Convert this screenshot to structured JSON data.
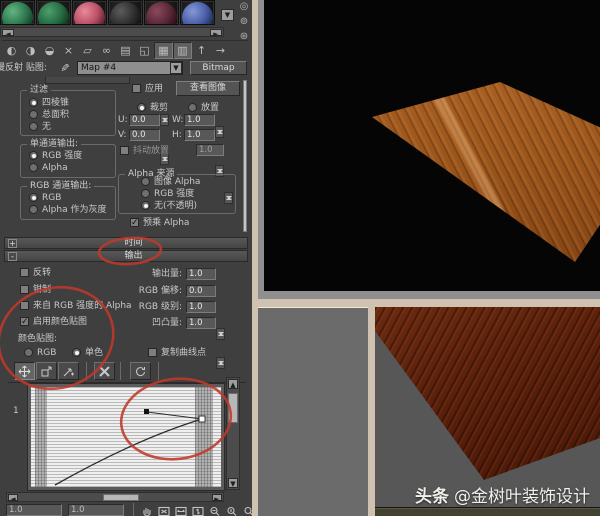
{
  "colors": {
    "annotation": "#c0392b",
    "panel_bg": "#3f3f3f",
    "window_frame_beige": "#cfc2b0",
    "render_bg": "#050505",
    "viewport_bg": "#575757",
    "wood_light": "#9a551c",
    "wood_dark": "#581f0b"
  },
  "sample_slots": [
    {
      "name": "sample-sphere-green-1",
      "color": "#2e7a50"
    },
    {
      "name": "sample-sphere-green-2",
      "color": "#256b42"
    },
    {
      "name": "sample-sphere-rose",
      "color": "#b94f66"
    },
    {
      "name": "sample-sphere-black",
      "color": "#303030"
    },
    {
      "name": "sample-sphere-maroon",
      "color": "#5c2737"
    },
    {
      "name": "sample-sphere-blue",
      "color": "#4a5fa8"
    }
  ],
  "top_toolbar": {
    "icons": [
      {
        "name": "get-material-icon",
        "glyph": "◐"
      },
      {
        "name": "put-material-to-scene-icon",
        "glyph": "◑"
      },
      {
        "name": "assign-material-to-selection-icon",
        "glyph": "◒"
      },
      {
        "name": "reset-map-icon",
        "glyph": "×"
      },
      {
        "name": "make-material-copy-icon",
        "glyph": "▱"
      },
      {
        "name": "make-unique-icon",
        "glyph": "∞"
      },
      {
        "name": "put-to-library-icon",
        "glyph": "▤"
      },
      {
        "name": "material-id-channel-icon",
        "glyph": "◱"
      },
      {
        "name": "show-map-in-viewport-icon",
        "glyph": "▦",
        "pressed": true
      },
      {
        "name": "show-end-result-icon",
        "glyph": "▥",
        "pressed": true
      },
      {
        "name": "go-to-parent-icon",
        "glyph": "↑"
      },
      {
        "name": "go-forward-to-sibling-icon",
        "glyph": "→"
      }
    ]
  },
  "side_icons": [
    {
      "name": "sample-uv-tiling-icon",
      "glyph": "◎"
    },
    {
      "name": "video-color-check-icon",
      "glyph": "⊚"
    },
    {
      "name": "options-icon",
      "glyph": "⊛"
    }
  ],
  "map_row": {
    "label": "漫反射 贴图:",
    "map_name": "Map #4",
    "type_button_label": "Bitmap"
  },
  "params": {
    "filter": {
      "title": "过滤",
      "options": [
        {
          "label": "四棱锥",
          "selected": true
        },
        {
          "label": "总面积",
          "selected": false
        },
        {
          "label": "无",
          "selected": false
        }
      ]
    },
    "apply_label": "应用",
    "view_image_label": "查看图像",
    "crop_label": "裁剪",
    "crop_selected": true,
    "place_label": "放置",
    "place_selected": false,
    "u": {
      "label": "U:",
      "value": "0.0"
    },
    "v": {
      "label": "V:",
      "value": "0.0"
    },
    "w": {
      "label": "W:",
      "value": "1.0"
    },
    "h": {
      "label": "H:",
      "value": "1.0"
    },
    "jitter": {
      "label": "抖动放置",
      "value": "1.0",
      "checked": false
    },
    "mono": {
      "title": "单通道输出:",
      "options": [
        {
          "label": "RGB 强度",
          "selected": true
        },
        {
          "label": "Alpha",
          "selected": false
        }
      ]
    },
    "rgb_out": {
      "title": "RGB 通道输出:",
      "options": [
        {
          "label": "RGB",
          "selected": true
        },
        {
          "label": "Alpha 作为灰度",
          "selected": false
        }
      ]
    },
    "alpha_source": {
      "title": "Alpha 来源",
      "options": [
        {
          "label": "图像 Alpha",
          "selected": false
        },
        {
          "label": "RGB 强度",
          "selected": false
        },
        {
          "label": "无(不透明)",
          "selected": true
        }
      ]
    },
    "premult_label": "预乘 Alpha",
    "premult_checked": true
  },
  "rollouts": {
    "time": {
      "state": "+",
      "label": "时间"
    },
    "output": {
      "state": "-",
      "label": "输出"
    }
  },
  "output": {
    "checks": [
      {
        "label": "反转",
        "checked": false
      },
      {
        "label": "钳制",
        "checked": false
      },
      {
        "label": "来自 RGB 强度的 Alpha",
        "checked": false
      },
      {
        "label": "启用颜色贴图",
        "checked": true
      }
    ],
    "spinners": [
      {
        "label": "输出量:",
        "value": "1.0"
      },
      {
        "label": "RGB 偏移:",
        "value": "0.0"
      },
      {
        "label": "RGB 级别:",
        "value": "1.0"
      },
      {
        "label": "凹凸量:",
        "value": "1.0"
      }
    ],
    "color_map": {
      "title": "颜色贴图:",
      "rgb_label": "RGB",
      "mono_label": "单色",
      "mono_selected": true,
      "copy_label": "复制曲线点",
      "copy_checked": false
    },
    "curve_toolbar": [
      {
        "name": "move-point-icon",
        "pressed": true
      },
      {
        "name": "scale-point-icon",
        "pressed": false
      },
      {
        "name": "add-point-icon",
        "pressed": false
      },
      {
        "name": "delete-point-icon",
        "pressed": false
      },
      {
        "name": "reset-curves-icon",
        "pressed": false
      }
    ],
    "graph": {
      "row_label": "1",
      "field1": "1.0",
      "field2": "1.0"
    }
  },
  "watermark": {
    "bold": "头条",
    "rest": "@金树叶装饰设计"
  }
}
